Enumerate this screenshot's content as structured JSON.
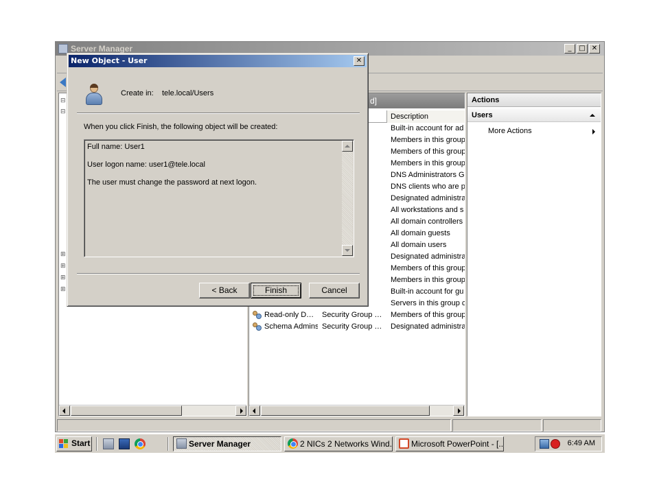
{
  "window": {
    "title": "Server Manager",
    "controls": {
      "minimize": "_",
      "maximize": "□",
      "close": "✕"
    }
  },
  "list_pane": {
    "header_text": "d]",
    "column_description": "Description",
    "rows": [
      {
        "name": "",
        "type": "",
        "desc": "Built-in account for ad"
      },
      {
        "name": "",
        "type": "…",
        "desc": "Members in this group"
      },
      {
        "name": "",
        "type": "…",
        "desc": "Members of this group"
      },
      {
        "name": "",
        "type": "…",
        "desc": "Members in this group"
      },
      {
        "name": "",
        "type": "…",
        "desc": "DNS Administrators Gr"
      },
      {
        "name": "",
        "type": "…",
        "desc": "DNS clients who are p"
      },
      {
        "name": "",
        "type": "…",
        "desc": "Designated administra"
      },
      {
        "name": "",
        "type": "…",
        "desc": "All workstations and s"
      },
      {
        "name": "",
        "type": "…",
        "desc": "All domain controllers i"
      },
      {
        "name": "",
        "type": "…",
        "desc": "All domain guests"
      },
      {
        "name": "",
        "type": "…",
        "desc": "All domain users"
      },
      {
        "name": "",
        "type": "…",
        "desc": "Designated administra"
      },
      {
        "name": "",
        "type": "…",
        "desc": "Members of this group"
      },
      {
        "name": "",
        "type": "…",
        "desc": "Members in this group"
      },
      {
        "name": "",
        "type": "",
        "desc": "Built-in account for gu"
      },
      {
        "name": "",
        "type": "…",
        "desc": "Servers in this group c"
      },
      {
        "name": "Read-only D…",
        "type": "Security Group …",
        "desc": "Members of this group"
      },
      {
        "name": "Schema Admins",
        "type": "Security Group …",
        "desc": "Designated administra"
      }
    ]
  },
  "actions": {
    "title": "Actions",
    "section": "Users",
    "items": [
      "More Actions"
    ]
  },
  "dialog": {
    "title": "New Object - User",
    "close": "✕",
    "create_in_label": "Create in:",
    "create_in_value": "tele.local/Users",
    "intro": "When you click Finish, the following object will be created:",
    "summary": [
      "Full name: User1",
      "User logon name: user1@tele.local",
      "The user must change the password at next logon."
    ],
    "buttons": {
      "back": "< Back",
      "finish": "Finish",
      "cancel": "Cancel"
    }
  },
  "taskbar": {
    "start": "Start",
    "tasks": [
      {
        "label": "Server Manager",
        "active": true
      },
      {
        "label": "2 NICs 2 Networks Wind...",
        "active": false
      },
      {
        "label": "Microsoft PowerPoint - [...",
        "active": false
      }
    ],
    "clock": "6:49 AM"
  }
}
